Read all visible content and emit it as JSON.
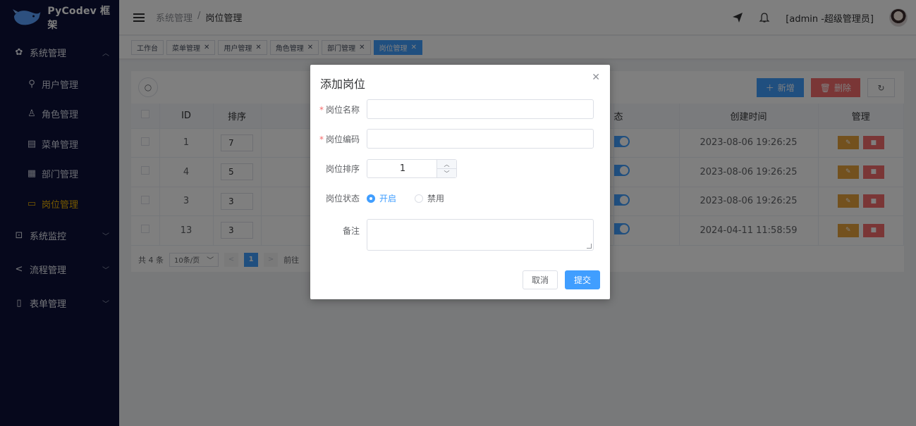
{
  "app": {
    "logo_text": "PyCodev 框架"
  },
  "sidebar": {
    "groups": [
      {
        "label": "系统管理",
        "icon": "gear-icon",
        "expanded": true
      },
      {
        "label": "系统监控",
        "icon": "monitor-icon"
      },
      {
        "label": "流程管理",
        "icon": "share-icon"
      },
      {
        "label": "表单管理",
        "icon": "form-icon"
      }
    ],
    "items": [
      {
        "label": "用户管理",
        "icon": "user-icon"
      },
      {
        "label": "角色管理",
        "icon": "role-icon"
      },
      {
        "label": "菜单管理",
        "icon": "menu-icon"
      },
      {
        "label": "部门管理",
        "icon": "dept-icon"
      },
      {
        "label": "岗位管理",
        "icon": "post-icon",
        "active": true
      }
    ]
  },
  "header": {
    "breadcrumb": [
      "系统管理",
      "/",
      "岗位管理"
    ],
    "user": "[admin -超级管理员]"
  },
  "tabs": [
    {
      "label": "工作台",
      "closable": false
    },
    {
      "label": "菜单管理",
      "closable": true
    },
    {
      "label": "用户管理",
      "closable": true
    },
    {
      "label": "角色管理",
      "closable": true
    },
    {
      "label": "部门管理",
      "closable": true
    },
    {
      "label": "岗位管理",
      "closable": true,
      "active": true
    }
  ],
  "toolbar": {
    "add_label": "新增",
    "delete_label": "删除"
  },
  "table": {
    "columns": [
      "ID",
      "排序",
      "态",
      "创建时间",
      "管理"
    ],
    "rows": [
      {
        "id": "1",
        "sort": "7",
        "created": "2023-08-06 19:26:25"
      },
      {
        "id": "4",
        "sort": "5",
        "created": "2023-08-06 19:26:25"
      },
      {
        "id": "3",
        "sort": "3",
        "created": "2023-08-06 19:26:25"
      },
      {
        "id": "13",
        "sort": "3",
        "created": "2024-04-11 11:58:59"
      }
    ]
  },
  "pager": {
    "total": "共 4 条",
    "page_size": "10条/页",
    "current": "1",
    "goto": "前往"
  },
  "dialog": {
    "title": "添加岗位",
    "fields": {
      "name_label": "岗位名称",
      "code_label": "岗位编码",
      "sort_label": "岗位排序",
      "sort_value": "1",
      "status_label": "岗位状态",
      "status_on": "开启",
      "status_off": "禁用",
      "remark_label": "备注"
    },
    "cancel_label": "取消",
    "submit_label": "提交"
  },
  "colors": {
    "sidebar_bg": "#0c1138",
    "primary": "#409eff",
    "danger": "#f56c6c",
    "warning": "#e6a23c",
    "active_menu": "#f0b400"
  }
}
